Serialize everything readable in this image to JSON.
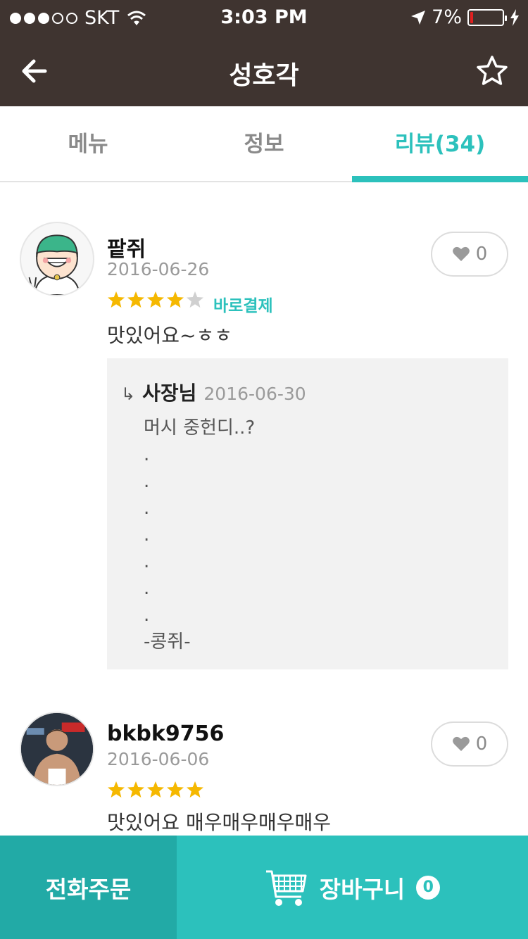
{
  "status_bar": {
    "carrier": "SKT",
    "time": "3:03 PM",
    "battery": "7%"
  },
  "header": {
    "title": "성호각"
  },
  "tabs": [
    {
      "label": "메뉴"
    },
    {
      "label": "정보"
    },
    {
      "label": "리뷰(34)"
    }
  ],
  "reviews": [
    {
      "author": "팥쥐",
      "date": "2016-06-26",
      "rating": 4,
      "badge": "바로결제",
      "text": "맛있어요~ㅎㅎ",
      "likes": "0",
      "reply": {
        "arrow": "↳",
        "author": "사장님",
        "date": "2016-06-30",
        "lines": [
          "머시 중헌디..?",
          ".",
          ".",
          ".",
          ".",
          ".",
          ".",
          ".",
          "-콩쥐-"
        ]
      }
    },
    {
      "author": "bkbk9756",
      "date": "2016-06-06",
      "rating": 5,
      "text": "맛있어요 매우매우매우매우",
      "likes": "0"
    }
  ],
  "bottom_bar": {
    "phone_order": "전화주문",
    "cart": "장바구니",
    "cart_count": "0"
  },
  "colors": {
    "header_bg": "#3f3430",
    "accent": "#2cc1bc",
    "accent_dark": "#22aaa6",
    "star": "#f5b800"
  }
}
